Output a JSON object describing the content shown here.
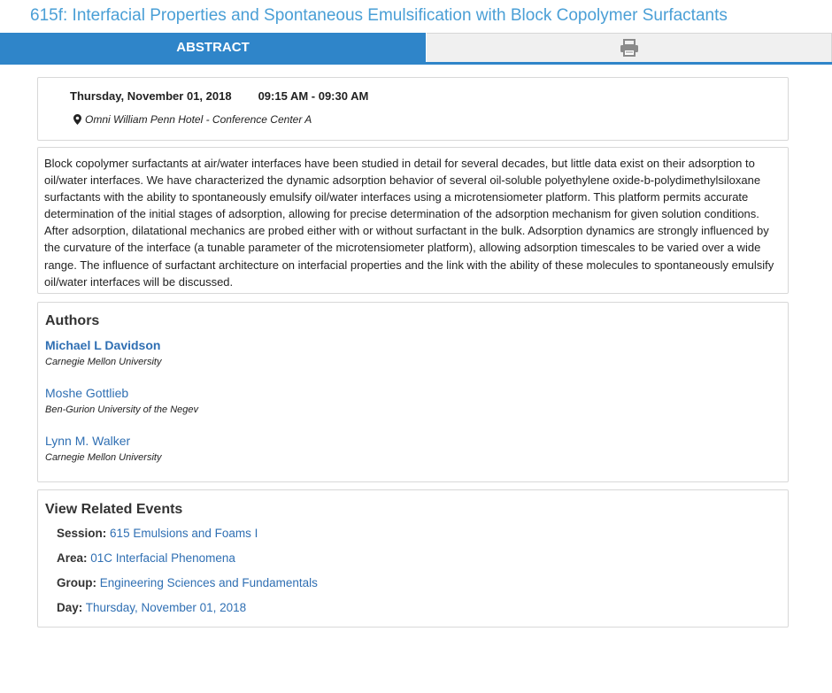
{
  "page": {
    "title": "615f: Interfacial Properties and Spontaneous Emulsification with Block Copolymer Surfactants"
  },
  "tabs": {
    "abstract_label": "ABSTRACT",
    "print_icon": "printer-icon"
  },
  "session_info": {
    "date": "Thursday, November 01, 2018",
    "time": "09:15 AM - 09:30 AM",
    "location_icon": "map-marker-icon",
    "location": "Omni William Penn Hotel - Conference Center A"
  },
  "abstract": {
    "text": "Block copolymer surfactants at air/water interfaces have been studied in detail for several decades, but little data exist on their adsorption to oil/water interfaces. We have characterized the dynamic adsorption behavior of several oil-soluble polyethylene oxide-b-polydimethylsiloxane surfactants with the ability to spontaneously emulsify oil/water interfaces using a microtensiometer platform. This platform permits accurate determination of the initial stages of adsorption, allowing for precise determination of the adsorption mechanism for given solution conditions. After adsorption, dilatational mechanics are probed either with or without surfactant in the bulk. Adsorption dynamics are strongly influenced by the curvature of the interface (a tunable parameter of the microtensiometer platform), allowing adsorption timescales to be varied over a wide range. The influence of surfactant architecture on interfacial properties and the link with the ability of these molecules to spontaneously emulsify oil/water interfaces will be discussed."
  },
  "authors": {
    "heading": "Authors",
    "list": [
      {
        "name": "Michael L Davidson",
        "affiliation": "Carnegie Mellon University"
      },
      {
        "name": "Moshe Gottlieb",
        "affiliation": "Ben-Gurion University of the Negev"
      },
      {
        "name": "Lynn M. Walker",
        "affiliation": "Carnegie Mellon University"
      }
    ]
  },
  "related": {
    "heading": "View Related Events",
    "rows": [
      {
        "label": "Session:",
        "value": "615 Emulsions and Foams I"
      },
      {
        "label": "Area:",
        "value": "01C Interfacial Phenomena"
      },
      {
        "label": "Group:",
        "value": "Engineering Sciences and Fundamentals"
      },
      {
        "label": "Day:",
        "value": "Thursday, November 01, 2018"
      }
    ]
  },
  "colors": {
    "title": "#4a9fd6",
    "tab_active": "#2f85c9",
    "link": "#2f6fb3"
  }
}
